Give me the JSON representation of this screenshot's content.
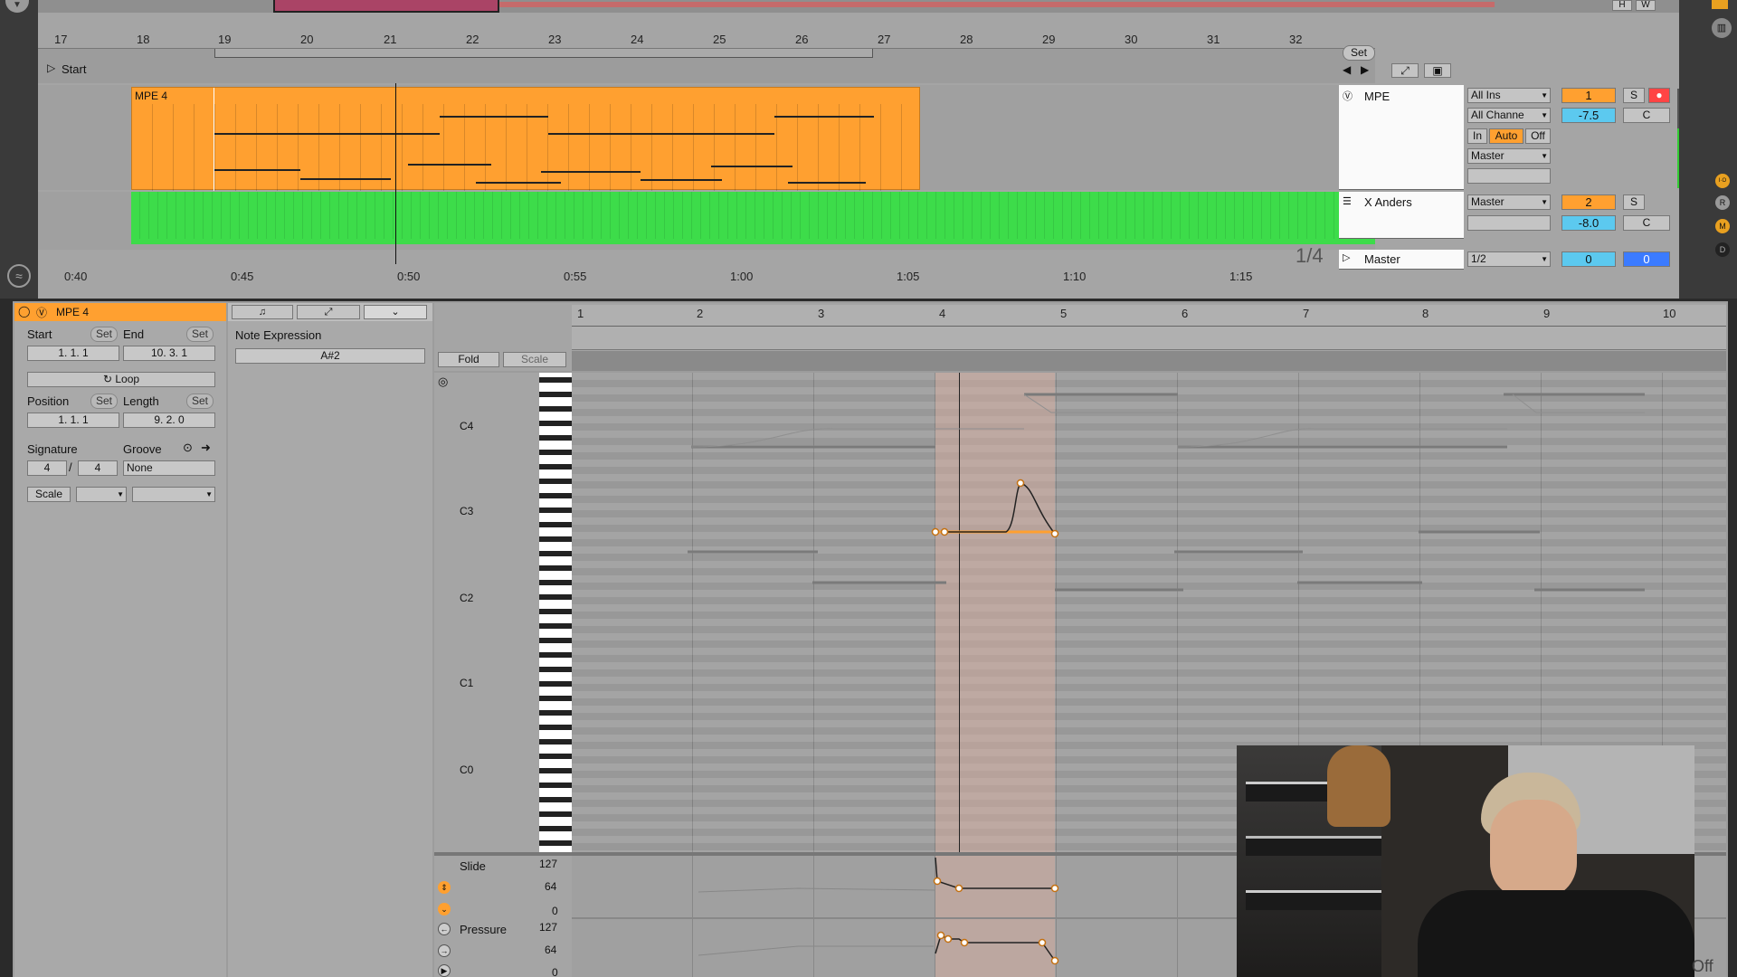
{
  "arrangement": {
    "bar_numbers": [
      "17",
      "18",
      "19",
      "20",
      "21",
      "22",
      "23",
      "24",
      "25",
      "26",
      "27",
      "28",
      "29",
      "30",
      "31",
      "32"
    ],
    "start_marker": "Start",
    "set_label": "Set",
    "quantize": "1/4",
    "time_labels": [
      "0:40",
      "0:45",
      "0:50",
      "0:55",
      "1:00",
      "1:05",
      "1:10",
      "1:15"
    ],
    "top_buttons": [
      "H",
      "W"
    ]
  },
  "tracks": [
    {
      "name": "MPE",
      "input": "All Ins",
      "channel": "All Channe",
      "monitor": [
        "In",
        "Auto",
        "Off"
      ],
      "output": "Master",
      "number": "1",
      "solo": "S",
      "volume": "-7.5",
      "pan": "C"
    },
    {
      "name": "X Anders",
      "output": "Master",
      "number": "2",
      "solo": "S",
      "volume": "-8.0",
      "pan": "C"
    },
    {
      "name": "Master",
      "output": "1/2",
      "volume": "0",
      "pan": "0"
    }
  ],
  "clips": {
    "arrangement_clip": "MPE 4"
  },
  "side_buttons": [
    "I·O",
    "R",
    "M",
    "D"
  ],
  "clip_panel": {
    "clip_name": "MPE 4",
    "start_label": "Start",
    "end_label": "End",
    "set": "Set",
    "start_value": "1.  1.  1",
    "end_value": "10.  3.  1",
    "loop_label": "Loop",
    "position_label": "Position",
    "length_label": "Length",
    "position_value": "1.  1.  1",
    "length_value": "9.  2.  0",
    "signature_label": "Signature",
    "groove_label": "Groove",
    "sig_num": "4",
    "sig_den": "4",
    "groove_value": "None",
    "scale_label": "Scale"
  },
  "note_expression": {
    "title": "Note Expression",
    "note": "A#2",
    "fold": "Fold",
    "scale": "Scale"
  },
  "midi_editor": {
    "bars": [
      "1",
      "2",
      "3",
      "4",
      "5",
      "6",
      "7",
      "8",
      "9",
      "10"
    ],
    "octaves": [
      "C4",
      "C3",
      "C2",
      "C1",
      "C0"
    ],
    "lanes": [
      {
        "name": "Slide",
        "max": "127",
        "mid": "64",
        "min": "0"
      },
      {
        "name": "Pressure",
        "max": "127",
        "mid": "64",
        "min": "0"
      }
    ]
  },
  "overlay_text": "Off",
  "colors": {
    "clip_orange": "#ffa030",
    "clip_green": "#3ddc4a",
    "accent_blue": "#5cc9ef",
    "master_blue": "#3b7bff"
  }
}
